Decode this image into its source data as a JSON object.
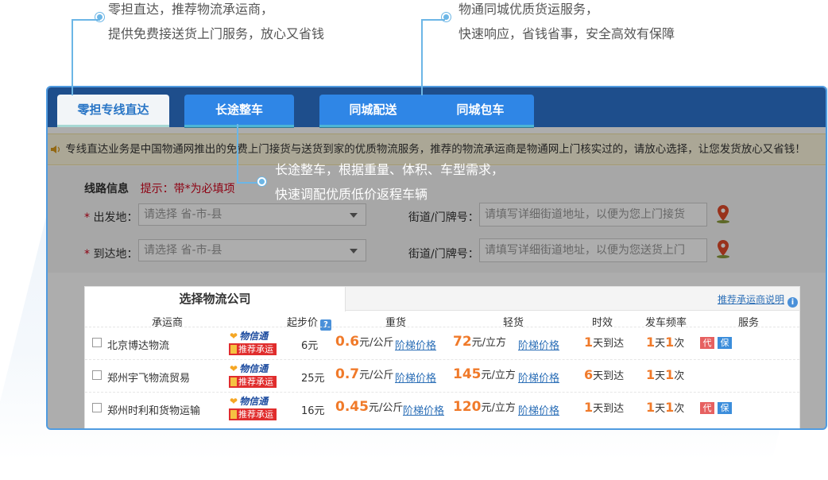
{
  "callouts": {
    "top_left": {
      "line1": "零担直达，推荐物流承运商，",
      "line2": "提供免费接送货上门服务，放心又省钱"
    },
    "top_right": {
      "line1": "物通同城优质货运服务，",
      "line2": "快速响应，省钱省事，安全高效有保障"
    },
    "middle": {
      "line1": "长途整车，根据重量、体积、车型需求，",
      "line2": "快速调配优质低价返程车辆"
    }
  },
  "tabs": {
    "ltl": "零担专线直达",
    "long_haul": "长途整车",
    "city_delivery": "同城配送",
    "city_charter": "同城包车"
  },
  "notice": "专线直达业务是中国物通网推出的免费上门接货与送货到家的优质物流服务，推荐的物流承运商是物通网上门核实过的，请放心选择，让您发货放心又省钱！",
  "form": {
    "section_title": "线路信息",
    "hint": "提示：带*为必填项",
    "required_mark": "*",
    "origin_label": "出发地：",
    "origin_placeholder": "请选择 省-市-县",
    "dest_label": "到达地：",
    "dest_placeholder": "请选择 省-市-县",
    "street_label": "街道/门牌号：",
    "origin_street_placeholder": "请填写详细街道地址，以便为您上门接货",
    "dest_street_placeholder": "请填写详细街道地址，以便为您送货上门"
  },
  "results": {
    "tab_label": "选择物流公司",
    "explain_link": "推荐承运商说明",
    "columns": {
      "carrier": "承运商",
      "start_price": "起步价",
      "heavy": "重货",
      "light": "轻货",
      "time": "时效",
      "frequency": "发车频率",
      "service": "服务"
    },
    "logo_text": "物信通",
    "recommend_text": "推荐承运商",
    "tier_link": "阶梯价格",
    "rows": [
      {
        "name": "北京博达物流",
        "start": "6元",
        "heavy_value": "0.6",
        "heavy_unit": "元/公斤",
        "light_value": "72",
        "light_unit": "元/立方",
        "time_value": "1",
        "time_unit": "天到达",
        "freq_a": "1",
        "freq_mid": "天",
        "freq_b": "1",
        "freq_unit": "次",
        "svc_dai": "代",
        "svc_bao": "保"
      },
      {
        "name": "郑州宇飞物流贸易",
        "start": "25元",
        "heavy_value": "0.7",
        "heavy_unit": "元/公斤",
        "light_value": "145",
        "light_unit": "元/立方",
        "time_value": "6",
        "time_unit": "天到达",
        "freq_a": "1",
        "freq_mid": "天",
        "freq_b": "1",
        "freq_unit": "次",
        "svc_dai": "",
        "svc_bao": ""
      },
      {
        "name": "郑州时利和货物运输",
        "start": "16元",
        "heavy_value": "0.45",
        "heavy_unit": "元/公斤",
        "light_value": "120",
        "light_unit": "元/立方",
        "time_value": "1",
        "time_unit": "天到达",
        "freq_a": "1",
        "freq_mid": "天",
        "freq_b": "1",
        "freq_unit": "次",
        "svc_dai": "代",
        "svc_bao": "保"
      }
    ]
  }
}
